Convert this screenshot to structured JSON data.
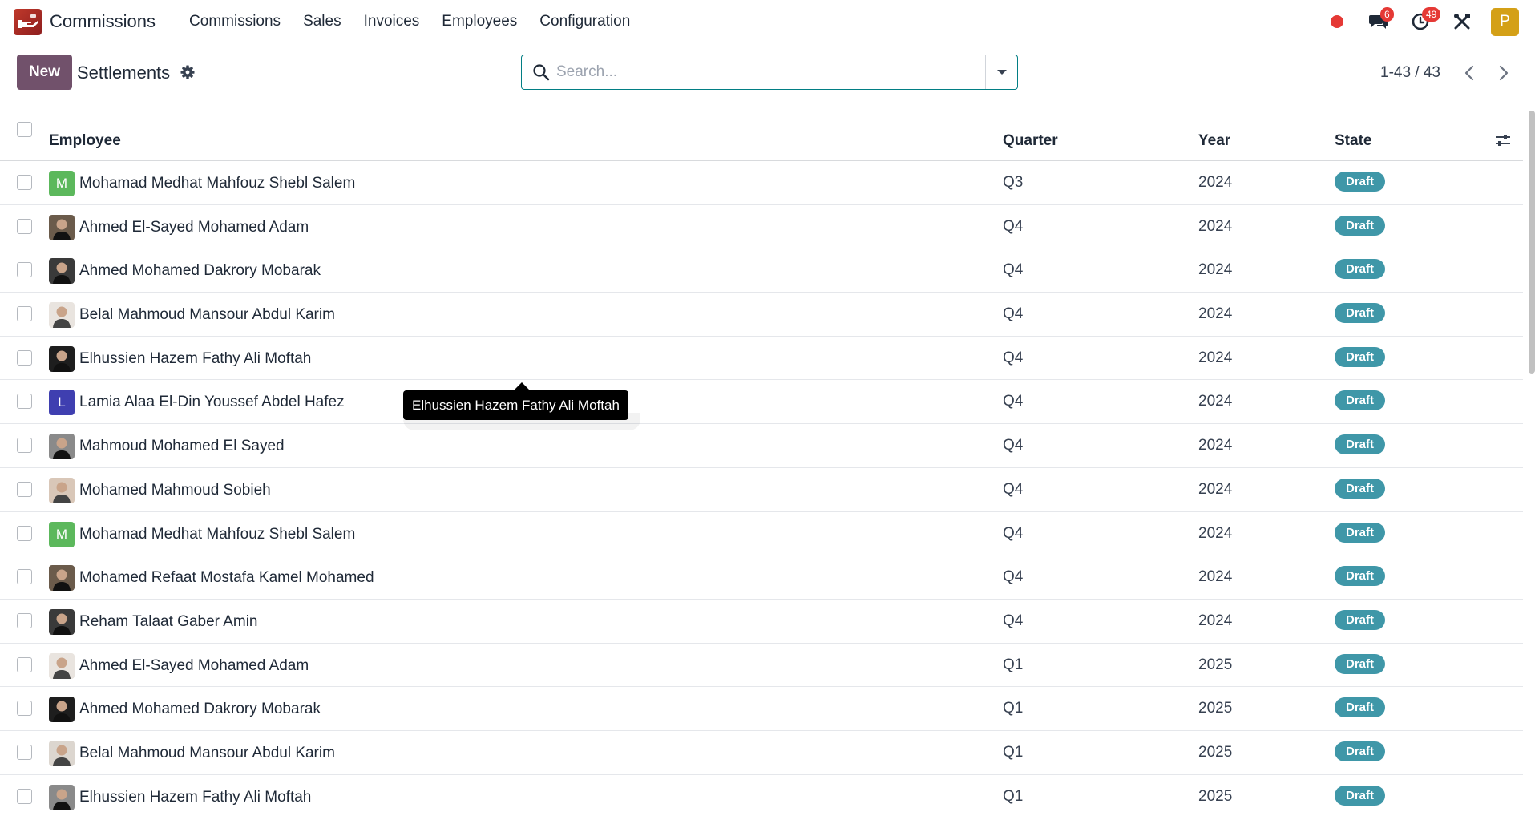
{
  "navbar": {
    "app_name": "Commissions",
    "menu": [
      "Commissions",
      "Sales",
      "Invoices",
      "Employees",
      "Configuration"
    ],
    "messages_badge": "6",
    "activities_badge": "49",
    "user_initial": "P",
    "colors": {
      "record": "#e53935",
      "avatar": "#d4a017",
      "logo": "#c0392b"
    }
  },
  "control": {
    "new_label": "New",
    "title": "Settlements",
    "search_placeholder": "Search...",
    "pager": "1-43 / 43",
    "colors": {
      "primary": "#71516b",
      "search_border": "#017e84"
    }
  },
  "list": {
    "headers": {
      "employee": "Employee",
      "quarter": "Quarter",
      "year": "Year",
      "state": "State"
    },
    "state_color": "#3f97a8",
    "rows": [
      {
        "employee": "Mohamad Medhat Mahfouz Shebl Salem",
        "avatar": "M",
        "avatar_color": "#5cb85c",
        "quarter": "Q3",
        "year": "2024",
        "state": "Draft"
      },
      {
        "employee": "Ahmed El-Sayed Mohamed Adam",
        "avatar": "photo",
        "quarter": "Q4",
        "year": "2024",
        "state": "Draft"
      },
      {
        "employee": "Ahmed Mohamed Dakrory Mobarak",
        "avatar": "photo",
        "quarter": "Q4",
        "year": "2024",
        "state": "Draft"
      },
      {
        "employee": "Belal Mahmoud Mansour Abdul Karim",
        "avatar": "photo",
        "quarter": "Q4",
        "year": "2024",
        "state": "Draft"
      },
      {
        "employee": "Elhussien Hazem Fathy Ali Moftah",
        "avatar": "photo",
        "quarter": "Q4",
        "year": "2024",
        "state": "Draft"
      },
      {
        "employee": "Lamia Alaa El-Din Youssef Abdel Hafez",
        "avatar": "L",
        "avatar_color": "#3f3fb0",
        "quarter": "Q4",
        "year": "2024",
        "state": "Draft"
      },
      {
        "employee": "Mahmoud Mohamed El Sayed",
        "avatar": "photo",
        "quarter": "Q4",
        "year": "2024",
        "state": "Draft"
      },
      {
        "employee": "Mohamed Mahmoud Sobieh",
        "avatar": "photo",
        "quarter": "Q4",
        "year": "2024",
        "state": "Draft"
      },
      {
        "employee": "Mohamad Medhat Mahfouz Shebl Salem",
        "avatar": "M",
        "avatar_color": "#5cb85c",
        "quarter": "Q4",
        "year": "2024",
        "state": "Draft"
      },
      {
        "employee": "Mohamed Refaat Mostafa Kamel Mohamed",
        "avatar": "photo",
        "quarter": "Q4",
        "year": "2024",
        "state": "Draft"
      },
      {
        "employee": "Reham Talaat Gaber Amin",
        "avatar": "photo",
        "quarter": "Q4",
        "year": "2024",
        "state": "Draft"
      },
      {
        "employee": "Ahmed El-Sayed Mohamed Adam",
        "avatar": "photo",
        "quarter": "Q1",
        "year": "2025",
        "state": "Draft"
      },
      {
        "employee": "Ahmed Mohamed Dakrory Mobarak",
        "avatar": "photo",
        "quarter": "Q1",
        "year": "2025",
        "state": "Draft"
      },
      {
        "employee": "Belal Mahmoud Mansour Abdul Karim",
        "avatar": "photo",
        "quarter": "Q1",
        "year": "2025",
        "state": "Draft"
      },
      {
        "employee": "Elhussien Hazem Fathy Ali Moftah",
        "avatar": "photo",
        "quarter": "Q1",
        "year": "2025",
        "state": "Draft"
      }
    ]
  },
  "tooltip": {
    "text": "Elhussien Hazem Fathy Ali Moftah"
  }
}
